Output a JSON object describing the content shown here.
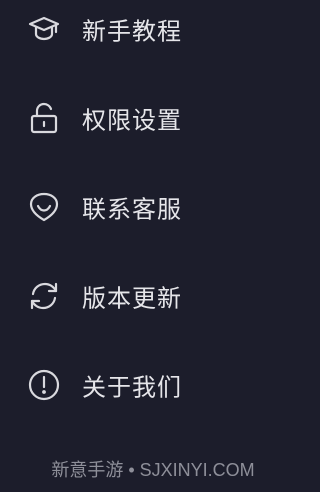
{
  "menu": {
    "items": [
      {
        "label": "新手教程",
        "icon": "graduation-cap-icon"
      },
      {
        "label": "权限设置",
        "icon": "unlock-icon"
      },
      {
        "label": "联系客服",
        "icon": "customer-service-icon"
      },
      {
        "label": "版本更新",
        "icon": "refresh-icon"
      },
      {
        "label": "关于我们",
        "icon": "info-icon"
      }
    ]
  },
  "footer": {
    "watermark": "新意手游 • SJXINYI.COM"
  },
  "colors": {
    "background": "#1c1d2b",
    "text": "#e6e6ea",
    "icon": "#d9d9de",
    "footer": "#8e8f99"
  }
}
